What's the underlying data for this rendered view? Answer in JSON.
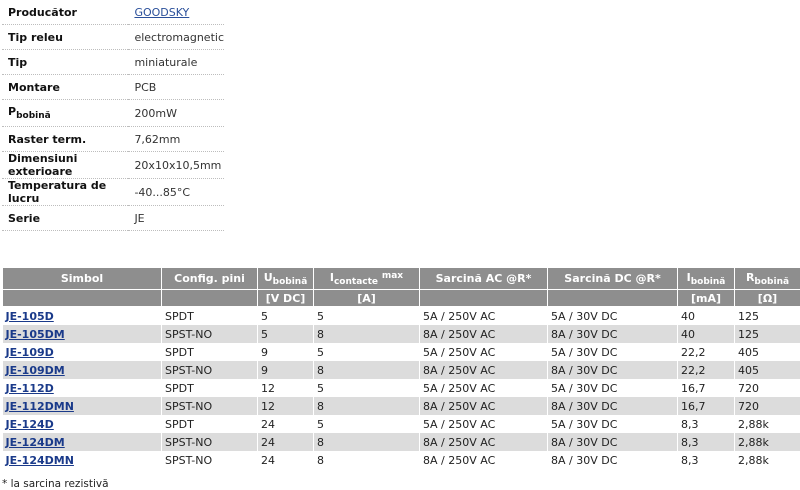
{
  "spec": {
    "producator_label": "Producător",
    "producator_value": "GOODSKY",
    "tip_releu_label": "Tip releu",
    "tip_releu_value": "electromagnetic",
    "tip_label": "Tip",
    "tip_value": "miniaturale",
    "montare_label": "Montare",
    "montare_value": "PCB",
    "pbobina_label_main": "P",
    "pbobina_label_sub": "bobină",
    "pbobina_value": "200mW",
    "raster_label": "Raster term.",
    "raster_value": "7,62mm",
    "dim_label": "Dimensiuni exterioare",
    "dim_value": "20x10x10,5mm",
    "temp_label": "Temperatura de lucru",
    "temp_value": "-40...85°C",
    "serie_label": "Serie",
    "serie_value": "JE"
  },
  "products": {
    "headers": {
      "simbol": "Simbol",
      "config": "Config. pini",
      "u_main": "U",
      "u_sub": "bobină",
      "i_main": "I",
      "i_sub": "contacte",
      "i_sup": "max",
      "sarcina_ac": "Sarcină AC @R*",
      "sarcina_dc": "Sarcină DC @R*",
      "ib_main": "I",
      "ib_sub": "bobină",
      "r_main": "R",
      "r_sub": "bobină"
    },
    "units": {
      "u": "[V DC]",
      "i": "[A]",
      "ib": "[mA]",
      "r": "[Ω]"
    },
    "rows": [
      {
        "simbol": "JE-105D",
        "config": "SPDT",
        "u": "5",
        "i": "5",
        "ac": "5A / 250V AC",
        "dc": "5A / 30V DC",
        "ib": "40",
        "r": "125"
      },
      {
        "simbol": "JE-105DM",
        "config": "SPST-NO",
        "u": "5",
        "i": "8",
        "ac": "8A / 250V AC",
        "dc": "8A / 30V DC",
        "ib": "40",
        "r": "125"
      },
      {
        "simbol": "JE-109D",
        "config": "SPDT",
        "u": "9",
        "i": "5",
        "ac": "5A / 250V AC",
        "dc": "5A / 30V DC",
        "ib": "22,2",
        "r": "405"
      },
      {
        "simbol": "JE-109DM",
        "config": "SPST-NO",
        "u": "9",
        "i": "8",
        "ac": "8A / 250V AC",
        "dc": "8A / 30V DC",
        "ib": "22,2",
        "r": "405"
      },
      {
        "simbol": "JE-112D",
        "config": "SPDT",
        "u": "12",
        "i": "5",
        "ac": "5A / 250V AC",
        "dc": "5A / 30V DC",
        "ib": "16,7",
        "r": "720"
      },
      {
        "simbol": "JE-112DMN",
        "config": "SPST-NO",
        "u": "12",
        "i": "8",
        "ac": "8A / 250V AC",
        "dc": "8A / 30V DC",
        "ib": "16,7",
        "r": "720"
      },
      {
        "simbol": "JE-124D",
        "config": "SPDT",
        "u": "24",
        "i": "5",
        "ac": "5A / 250V AC",
        "dc": "5A / 30V DC",
        "ib": "8,3",
        "r": "2,88k"
      },
      {
        "simbol": "JE-124DM",
        "config": "SPST-NO",
        "u": "24",
        "i": "8",
        "ac": "8A / 250V AC",
        "dc": "8A / 30V DC",
        "ib": "8,3",
        "r": "2,88k"
      },
      {
        "simbol": "JE-124DMN",
        "config": "SPST-NO",
        "u": "24",
        "i": "8",
        "ac": "8A / 250V AC",
        "dc": "8A / 30V DC",
        "ib": "8,3",
        "r": "2,88k"
      }
    ]
  },
  "footnote": "* la sarcina rezistivă"
}
